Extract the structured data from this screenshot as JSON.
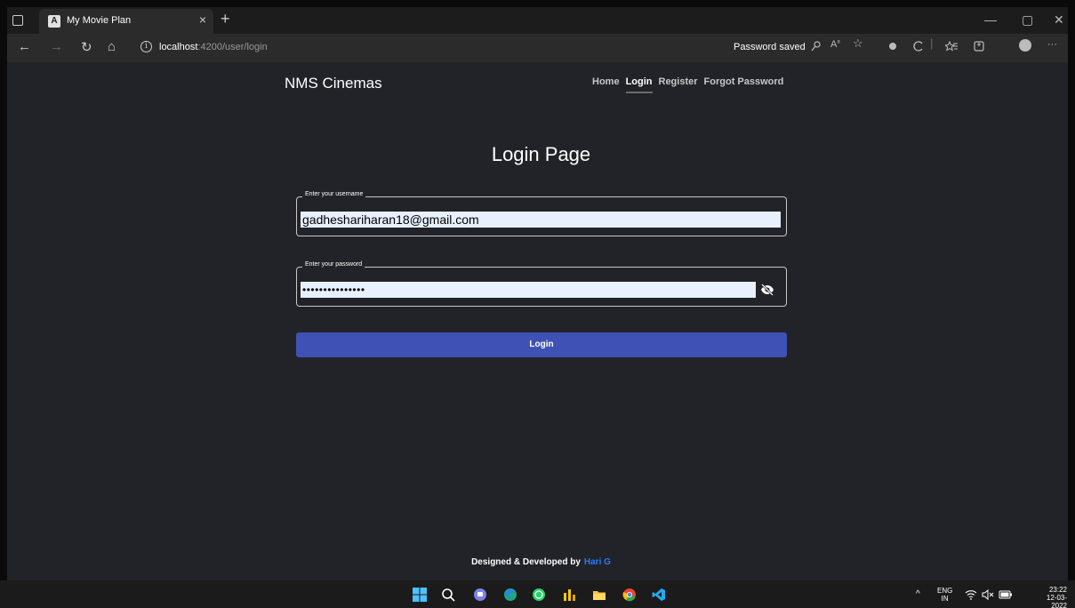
{
  "browser": {
    "tab_title": "My Movie Plan",
    "tab_favicon": "A",
    "tab_close": "×",
    "new_tab": "+",
    "url_host": "localhost",
    "url_path": ":4200/user/login",
    "password_saved": "Password saved",
    "window_controls": {
      "minimize": "—",
      "maximize": "▢",
      "close": "✕"
    },
    "nav_icons": {
      "back": "←",
      "forward": "→",
      "refresh": "↻",
      "home": "⌂",
      "info": "i",
      "more": "···"
    }
  },
  "site": {
    "brand": "NMS Cinemas",
    "nav": [
      {
        "label": "Home",
        "active": false
      },
      {
        "label": "Login",
        "active": true
      },
      {
        "label": "Register",
        "active": false
      },
      {
        "label": "Forgot Password",
        "active": false
      }
    ]
  },
  "form": {
    "title": "Login Page",
    "username": {
      "label": "Enter your username",
      "value": "gadheshariharan18@gmail.com"
    },
    "password": {
      "label": "Enter your password",
      "value": "•••••••••••••••"
    },
    "submit_label": "Login"
  },
  "footer": {
    "text": "Designed & Developed by",
    "author": "Hari G"
  },
  "taskbar": {
    "lang_line1": "ENG",
    "lang_line2": "IN",
    "time": "23:22",
    "date": "12-03-2022",
    "chevron": "^"
  },
  "colors": {
    "page_bg": "#212328",
    "primary_button": "#3f51b5",
    "author_link": "#2979ff",
    "input_bg": "#e8f0fe"
  }
}
